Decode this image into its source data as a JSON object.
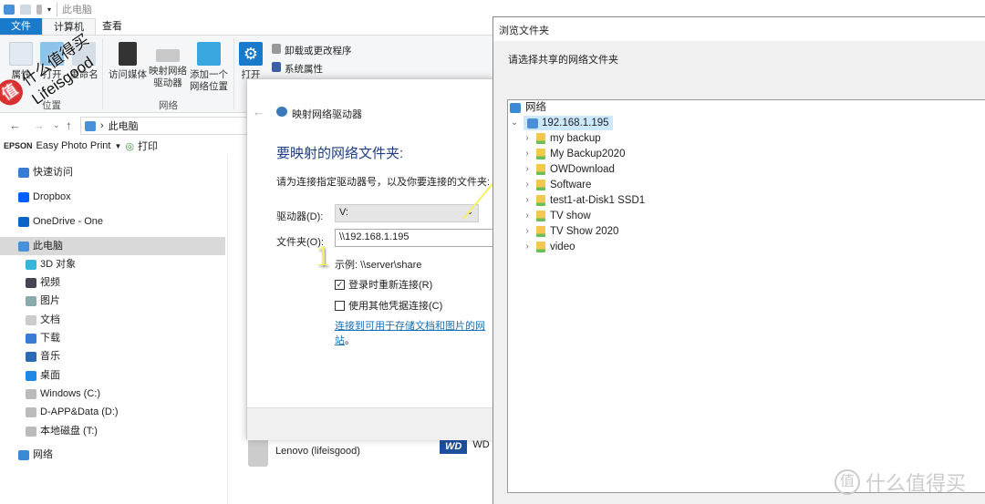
{
  "explorer": {
    "title": "此电脑",
    "tabs": [
      "文件",
      "计算机",
      "查看"
    ],
    "ribbon": {
      "location_buttons": [
        "属性",
        "打开",
        "重命名"
      ],
      "location_group": "位置",
      "network_buttons": [
        "访问媒体",
        "映射网络\n驱动器",
        "添加一个\n网络位置"
      ],
      "network_group": "网络",
      "open_settings": "打开\n设",
      "system_items": [
        "卸载或更改程序",
        "系统属性"
      ]
    },
    "address": "此电脑",
    "epson_brand": "EPSON",
    "epson_app": "Easy Photo Print",
    "epson_print": "打印",
    "sidebar": [
      {
        "label": "快速访问",
        "icon": "star-icon",
        "sub": false
      },
      {
        "label": "Dropbox",
        "icon": "dropbox-icon",
        "sub": false
      },
      {
        "label": "OneDrive - One",
        "icon": "cloud-icon",
        "sub": false
      },
      {
        "label": "此电脑",
        "icon": "computer-icon",
        "sub": false,
        "selected": true
      },
      {
        "label": "3D 对象",
        "icon": "cube-icon",
        "sub": true
      },
      {
        "label": "视频",
        "icon": "video-icon",
        "sub": true
      },
      {
        "label": "图片",
        "icon": "picture-icon",
        "sub": true
      },
      {
        "label": "文档",
        "icon": "document-icon",
        "sub": true
      },
      {
        "label": "下载",
        "icon": "download-icon",
        "sub": true
      },
      {
        "label": "音乐",
        "icon": "music-icon",
        "sub": true
      },
      {
        "label": "桌面",
        "icon": "desktop-icon",
        "sub": true
      },
      {
        "label": "Windows (C:)",
        "icon": "drive-icon",
        "sub": true
      },
      {
        "label": "D-APP&Data (D:)",
        "icon": "drive-icon",
        "sub": true
      },
      {
        "label": "本地磁盘 (T:)",
        "icon": "drive-icon",
        "sub": true
      },
      {
        "label": "网络",
        "icon": "network-icon",
        "sub": false
      }
    ],
    "device_items": [
      "Lenovo (lifeisgood)",
      "WD"
    ]
  },
  "map_dialog": {
    "title": "映射网络驱动器",
    "heading": "要映射的网络文件夹:",
    "instruction": "请为连接指定驱动器号，以及你要连接的文件夹:",
    "drive_label": "驱动器(D):",
    "drive_value": "V:",
    "folder_label": "文件夹(O):",
    "folder_value": "\\\\192.168.1.195",
    "example": "示例: \\\\server\\share",
    "reconnect_label": "登录时重新连接(R)",
    "reconnect_checked": true,
    "credentials_label": "使用其他凭据连接(C)",
    "credentials_checked": false,
    "link": "连接到可用于存储文档和图片的网站",
    "link_suffix": "。"
  },
  "browse_dialog": {
    "title": "浏览文件夹",
    "prompt": "请选择共享的网络文件夹",
    "root": "网络",
    "host": "192.168.1.195",
    "folders": [
      "my backup",
      "My Backup2020",
      "OWDownload",
      "Software",
      "test1-at-Disk1 SSD1",
      "TV show",
      "TV Show 2020",
      "video"
    ]
  },
  "annotations": [
    "1",
    "2"
  ],
  "watermark": {
    "top_left": "什么值得买 Lifeisgood",
    "bottom_right": "值 什么值得买"
  },
  "colors": {
    "accent": "#1979ca",
    "selection": "#cce8ff",
    "annotation": "#f5f060"
  }
}
